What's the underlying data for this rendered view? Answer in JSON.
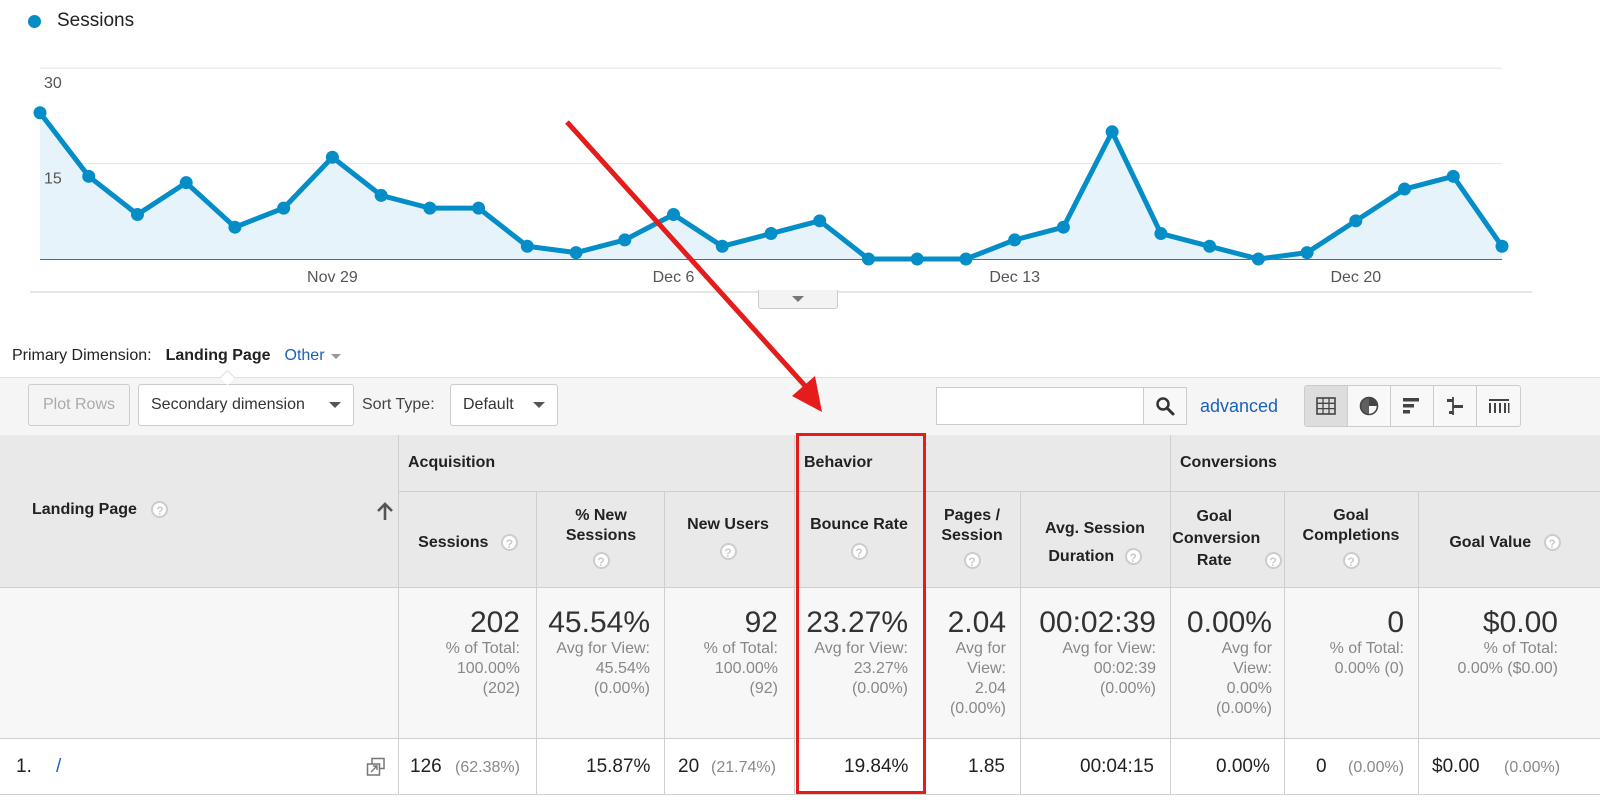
{
  "chart": {
    "legend": "Sessions",
    "y_ticks": [
      "30",
      "15"
    ],
    "x_ticks": [
      "Nov 29",
      "Dec 6",
      "Dec 13",
      "Dec 20"
    ],
    "line_color": "#058dc7",
    "fill_color": "#e6f3fa"
  },
  "chart_data": {
    "type": "area",
    "series": [
      {
        "name": "Sessions",
        "values": [
          23,
          13,
          7,
          12,
          5,
          8,
          16,
          10,
          8,
          8,
          2,
          1,
          3,
          7,
          2,
          4,
          6,
          0,
          0,
          0,
          3,
          5,
          20,
          4,
          2,
          0,
          1,
          6,
          11,
          13,
          2
        ]
      }
    ],
    "x_labels": [
      "Nov 29",
      "Dec 6",
      "Dec 13",
      "Dec 20"
    ],
    "ylim": [
      0,
      30
    ],
    "y_ticks": [
      15,
      30
    ],
    "grid": true
  },
  "primary_dimension": {
    "label": "Primary Dimension:",
    "active": "Landing Page",
    "other": "Other"
  },
  "toolbar": {
    "plot_rows": "Plot Rows",
    "secondary_dimension": "Secondary dimension",
    "sort_type_label": "Sort Type:",
    "sort_type_value": "Default",
    "search_placeholder": "",
    "advanced": "advanced",
    "view_icons": [
      "table-view-icon",
      "pie-view-icon",
      "performance-view-icon",
      "comparison-view-icon",
      "pivot-view-icon"
    ]
  },
  "table": {
    "dimension_header": "Landing Page",
    "groups": {
      "acquisition": "Acquisition",
      "behavior": "Behavior",
      "conversions": "Conversions"
    },
    "columns": {
      "sessions": "Sessions",
      "pct_new_sessions": "% New Sessions",
      "new_users": "New Users",
      "bounce_rate": "Bounce Rate",
      "pages_session": "Pages / Session",
      "avg_session_duration": "Avg. Session Duration",
      "goal_conversion_rate": "Goal Conversion Rate",
      "goal_completions": "Goal Completions",
      "goal_value": "Goal Value"
    },
    "totals": {
      "sessions": {
        "value": "202",
        "sub": "% of Total: 100.00% (202)"
      },
      "pct_new_sessions": {
        "value": "45.54%",
        "sub": "Avg for View: 45.54% (0.00%)"
      },
      "new_users": {
        "value": "92",
        "sub": "% of Total: 100.00% (92)"
      },
      "bounce_rate": {
        "value": "23.27%",
        "sub": "Avg for View: 23.27% (0.00%)"
      },
      "pages_session": {
        "value": "2.04",
        "sub": "Avg for View: 2.04 (0.00%)"
      },
      "avg_session_duration": {
        "value": "00:02:39",
        "sub": "Avg for View: 00:02:39 (0.00%)"
      },
      "goal_conversion_rate": {
        "value": "0.00%",
        "sub": "Avg for View: 0.00% (0.00%)"
      },
      "goal_completions": {
        "value": "0",
        "sub": "% of Total: 0.00% (0)"
      },
      "goal_value": {
        "value": "$0.00",
        "sub": "% of Total: 0.00% ($0.00)"
      }
    },
    "rows": [
      {
        "index": "1.",
        "landing_page": "/",
        "sessions": "126",
        "sessions_pct": "(62.38%)",
        "pct_new_sessions": "15.87%",
        "new_users": "20",
        "new_users_pct": "(21.74%)",
        "bounce_rate": "19.84%",
        "pages_session": "1.85",
        "avg_session_duration": "00:04:15",
        "goal_conversion_rate": "0.00%",
        "goal_completions": "0",
        "goal_completions_pct": "(0.00%)",
        "goal_value": "$0.00",
        "goal_value_pct": "(0.00%)"
      }
    ]
  },
  "annotation": {
    "arrow_color": "#e41c1c",
    "highlight_color": "#e41c1c"
  }
}
